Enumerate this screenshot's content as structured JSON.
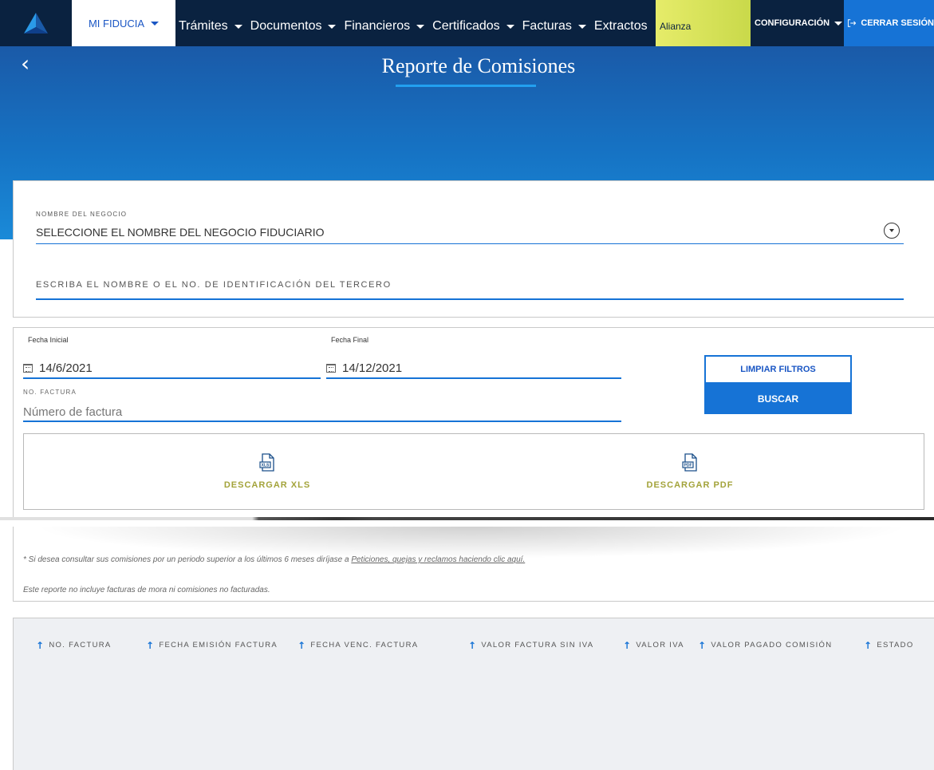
{
  "nav": {
    "mi_fiducia": "MI FIDUCIA",
    "items": [
      "Trámites",
      "Documentos",
      "Financieros",
      "Certificados",
      "Facturas",
      "Extractos"
    ],
    "alianza": "Alianza",
    "config": "CONFIGURACIÓN",
    "logout": "CERRAR SESIÓN"
  },
  "hero": {
    "back": "‹",
    "title": "Reporte de Comisiones"
  },
  "negocio": {
    "label": "NOMBRE DEL NEGOCIO",
    "placeholder": "SELECCIONE EL NOMBRE DEL NEGOCIO FIDUCIARIO",
    "tercero_placeholder": "ESCRIBA EL NOMBRE O EL NO. DE IDENTIFICACIÓN DEL TERCERO"
  },
  "filters": {
    "fecha_inicial_label": "Fecha Inicial",
    "fecha_inicial": "14/6/2021",
    "fecha_final_label": "Fecha Final",
    "fecha_final": "14/12/2021",
    "no_factura_label": "NO. FACTURA",
    "no_factura_placeholder": "Número de factura",
    "limpiar": "LIMPIAR FILTROS",
    "buscar": "BUSCAR"
  },
  "downloads": {
    "xls_tag": "XLS",
    "xls_label": "DESCARGAR XLS",
    "pdf_tag": "PDF",
    "pdf_label": "DESCARGAR PDF"
  },
  "notes": {
    "note1_prefix": "* Si desea consultar sus comisiones por un periodo superior a los últimos 6 meses diríjase a ",
    "note1_link": "Peticiones, quejas y reclamos haciendo clic aquí.",
    "note2": "Este reporte no incluye facturas de mora ni comisiones no facturadas."
  },
  "table": {
    "columns": [
      "NO. FACTURA",
      "FECHA EMISIÓN FACTURA",
      "FECHA VENC. FACTURA",
      "VALOR FACTURA SIN IVA",
      "VALOR IVA",
      "VALOR PAGADO COMISIÓN",
      "ESTADO"
    ],
    "sort_arrow": "🡑"
  },
  "colors": {
    "nav_bg": "#0a2240",
    "accent_blue": "#1673d6",
    "alianza_yellow": "#d8e35a",
    "download_olive": "#a3a33a"
  }
}
